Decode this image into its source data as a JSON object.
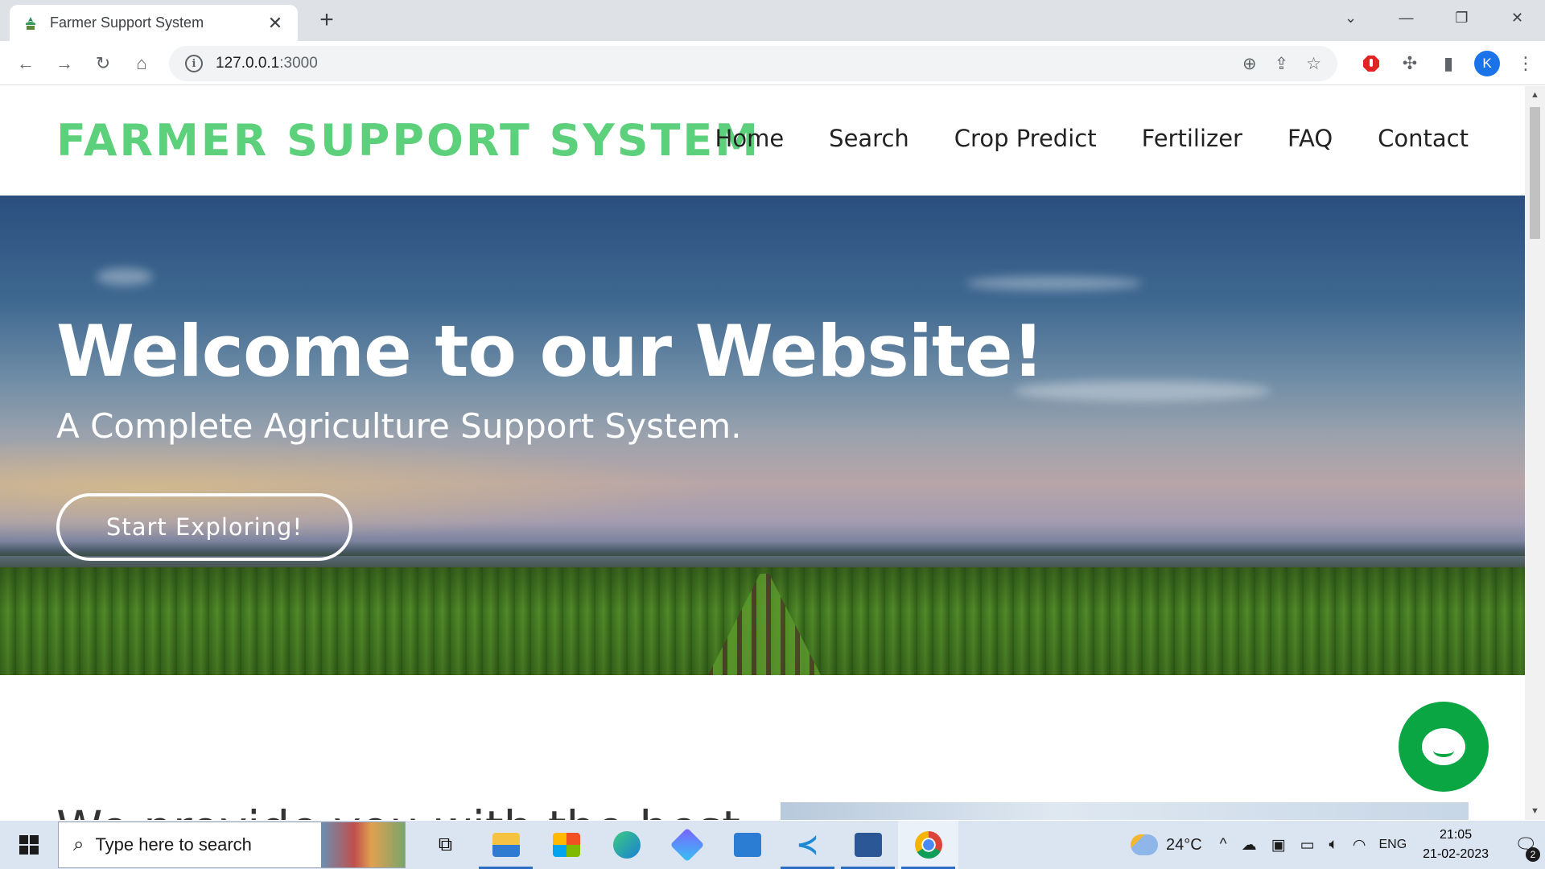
{
  "browser": {
    "tab_title": "Farmer Support System",
    "new_tab_symbol": "+",
    "url_host": "127.0.0.1",
    "url_port": ":3000",
    "profile_initial": "K"
  },
  "site": {
    "logo": "FARMER SUPPORT SYSTEM",
    "nav": [
      "Home",
      "Search",
      "Crop Predict",
      "Fertilizer",
      "FAQ",
      "Contact"
    ],
    "hero": {
      "title": "Welcome to our Website!",
      "subtitle": "A Complete Agriculture Support System.",
      "cta": "Start Exploring!"
    },
    "section2_title": "We provide you with the best"
  },
  "taskbar": {
    "search_placeholder": "Type here to search",
    "temperature": "24°C",
    "language": "ENG",
    "time": "21:05",
    "date": "21-02-2023",
    "notification_count": "2"
  },
  "colors": {
    "logo_green": "#5cd07a",
    "chat_green": "#0aa644",
    "profile_blue": "#1a73e8"
  }
}
